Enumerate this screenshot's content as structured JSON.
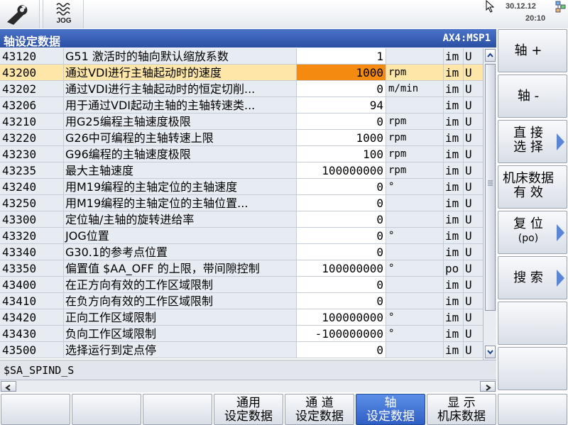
{
  "header": {
    "mode_label": "JOG",
    "date": "30.12.12",
    "time": "20:10"
  },
  "title_bar": {
    "title": "轴设定数据",
    "channel": "AX4:MSP1"
  },
  "table": {
    "rows": [
      {
        "num": "43120",
        "desc": "G51 激活时的轴向默认缩放系数",
        "value": "1",
        "unit": "",
        "act": "im",
        "prot": "U"
      },
      {
        "num": "43200",
        "desc": "通过VDI进行主轴起动时的速度",
        "value": "1000",
        "unit": "rpm",
        "act": "im",
        "prot": "U"
      },
      {
        "num": "43202",
        "desc": "通过VDI进行主轴起动时的恒定切削...",
        "value": "0",
        "unit": "m/min",
        "act": "im",
        "prot": "U"
      },
      {
        "num": "43206",
        "desc": "用于通过VDI起动主轴的主轴转速类...",
        "value": "94",
        "unit": "",
        "act": "im",
        "prot": "U"
      },
      {
        "num": "43210",
        "desc": "用G25编程主轴速度极限",
        "value": "0",
        "unit": "rpm",
        "act": "im",
        "prot": "U"
      },
      {
        "num": "43220",
        "desc": "G26中可编程的主轴转速上限",
        "value": "1000",
        "unit": "rpm",
        "act": "im",
        "prot": "U"
      },
      {
        "num": "43230",
        "desc": "G96编程的主轴速度极限",
        "value": "100",
        "unit": "rpm",
        "act": "im",
        "prot": "U"
      },
      {
        "num": "43235",
        "desc": "最大主轴速度",
        "value": "100000000",
        "unit": "rpm",
        "act": "im",
        "prot": "U"
      },
      {
        "num": "43240",
        "desc": "用M19编程的主轴定位的主轴速度",
        "value": "0",
        "unit": "°",
        "act": "im",
        "prot": "U"
      },
      {
        "num": "43250",
        "desc": "用M19编程的主轴定位的主轴位置...",
        "value": "0",
        "unit": "",
        "act": "im",
        "prot": "U"
      },
      {
        "num": "43300",
        "desc": "定位轴/主轴的旋转进给率",
        "value": "0",
        "unit": "",
        "act": "im",
        "prot": "U"
      },
      {
        "num": "43320",
        "desc": "JOG位置",
        "value": "0",
        "unit": "°",
        "act": "im",
        "prot": "U"
      },
      {
        "num": "43340",
        "desc": "G30.1的参考点位置",
        "value": "0",
        "unit": "",
        "act": "im",
        "prot": "U"
      },
      {
        "num": "43350",
        "desc": "偏置值 $AA_OFF 的上限，带间隙控制",
        "value": "100000000",
        "unit": "°",
        "act": "po",
        "prot": "U"
      },
      {
        "num": "43400",
        "desc": "在正方向有效的工作区域限制",
        "value": "0",
        "unit": "",
        "act": "im",
        "prot": "U"
      },
      {
        "num": "43410",
        "desc": "在负方向有效的工作区域限制",
        "value": "0",
        "unit": "",
        "act": "im",
        "prot": "U"
      },
      {
        "num": "43420",
        "desc": "正向工作区域限制",
        "value": "100000000",
        "unit": "°",
        "act": "im",
        "prot": "U"
      },
      {
        "num": "43430",
        "desc": "负向工作区域限制",
        "value": "-100000000",
        "unit": "°",
        "act": "im",
        "prot": "U"
      },
      {
        "num": "43500",
        "desc": "选择运行到定点停",
        "value": "0",
        "unit": "",
        "act": "im",
        "prot": "U"
      }
    ],
    "selected_index": 1
  },
  "status_line": "$SA_SPIND_S",
  "right_softkeys": [
    {
      "lines": [
        "轴 +"
      ],
      "arrow": false
    },
    {
      "lines": [
        "轴 -"
      ],
      "arrow": false
    },
    {
      "lines": [
        "直 接",
        "选 择"
      ],
      "arrow": true
    },
    {
      "lines": [
        "机床数据",
        "有  效"
      ],
      "arrow": false
    },
    {
      "lines": [
        "复 位",
        "(po)"
      ],
      "arrow": true
    },
    {
      "lines": [
        "搜 索"
      ],
      "arrow": true
    },
    {
      "lines": [],
      "arrow": false
    },
    {
      "lines": [],
      "arrow": false
    }
  ],
  "bottom_softkeys": [
    {
      "lines": [],
      "active": false
    },
    {
      "lines": [],
      "active": false
    },
    {
      "lines": [],
      "active": false
    },
    {
      "lines": [
        "通用",
        "设定数据"
      ],
      "active": false
    },
    {
      "lines": [
        "通  道",
        "设定数据"
      ],
      "active": false
    },
    {
      "lines": [
        "轴",
        "设定数据"
      ],
      "active": true
    },
    {
      "lines": [
        "显  示",
        "机床数据"
      ],
      "active": false
    },
    {
      "lines": [],
      "active": false
    }
  ],
  "colors": {
    "title_bar": "#2a4fa3",
    "selected_row": "#fde6a8",
    "selected_value": "#f58a10",
    "active_softkey": "#2f5fc4",
    "softkey_arrow": "#5a86d8"
  }
}
